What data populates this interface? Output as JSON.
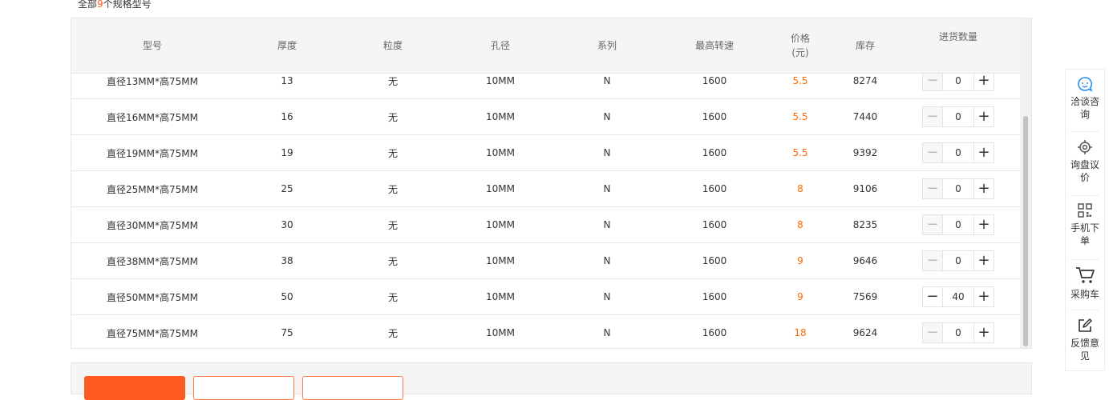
{
  "summary": {
    "prefix": "全部",
    "count": "9",
    "suffix": "个规格型号"
  },
  "table": {
    "headers": {
      "model": "型号",
      "thickness": "厚度",
      "grit": "粒度",
      "bore": "孔径",
      "series": "系列",
      "max_speed": "最高转速",
      "price": "价格(元)",
      "stock": "库存",
      "qty": "进货数量"
    },
    "rows": [
      {
        "model": "直径13MM*高75MM",
        "thickness": "13",
        "grit": "无",
        "bore": "10MM",
        "series": "N",
        "max_speed": "1600",
        "price": "5.5",
        "stock": "8274",
        "qty": "0"
      },
      {
        "model": "直径16MM*高75MM",
        "thickness": "16",
        "grit": "无",
        "bore": "10MM",
        "series": "N",
        "max_speed": "1600",
        "price": "5.5",
        "stock": "7440",
        "qty": "0"
      },
      {
        "model": "直径19MM*高75MM",
        "thickness": "19",
        "grit": "无",
        "bore": "10MM",
        "series": "N",
        "max_speed": "1600",
        "price": "5.5",
        "stock": "9392",
        "qty": "0"
      },
      {
        "model": "直径25MM*高75MM",
        "thickness": "25",
        "grit": "无",
        "bore": "10MM",
        "series": "N",
        "max_speed": "1600",
        "price": "8",
        "stock": "9106",
        "qty": "0"
      },
      {
        "model": "直径30MM*高75MM",
        "thickness": "30",
        "grit": "无",
        "bore": "10MM",
        "series": "N",
        "max_speed": "1600",
        "price": "8",
        "stock": "8235",
        "qty": "0"
      },
      {
        "model": "直径38MM*高75MM",
        "thickness": "38",
        "grit": "无",
        "bore": "10MM",
        "series": "N",
        "max_speed": "1600",
        "price": "9",
        "stock": "9646",
        "qty": "0"
      },
      {
        "model": "直径50MM*高75MM",
        "thickness": "50",
        "grit": "无",
        "bore": "10MM",
        "series": "N",
        "max_speed": "1600",
        "price": "9",
        "stock": "7569",
        "qty": "40"
      },
      {
        "model": "直径75MM*高75MM",
        "thickness": "75",
        "grit": "无",
        "bore": "10MM",
        "series": "N",
        "max_speed": "1600",
        "price": "18",
        "stock": "9624",
        "qty": "0"
      }
    ],
    "stepper": {
      "minus": "−",
      "plus": "+"
    }
  },
  "side_panel": {
    "items": [
      {
        "label": "洽谈咨询",
        "icon": "chat-bubble-icon"
      },
      {
        "label": "询盘议价",
        "icon": "target-icon"
      },
      {
        "label": "手机下单",
        "icon": "qr-code-icon"
      },
      {
        "label": "采购车",
        "icon": "cart-icon"
      },
      {
        "label": "反馈意见",
        "icon": "edit-icon"
      }
    ]
  },
  "colors": {
    "accent": "#ff5a1f",
    "price": "#ff6a00",
    "header_bg": "#f5f5f5",
    "icon_blue": "#2a8cf0"
  }
}
